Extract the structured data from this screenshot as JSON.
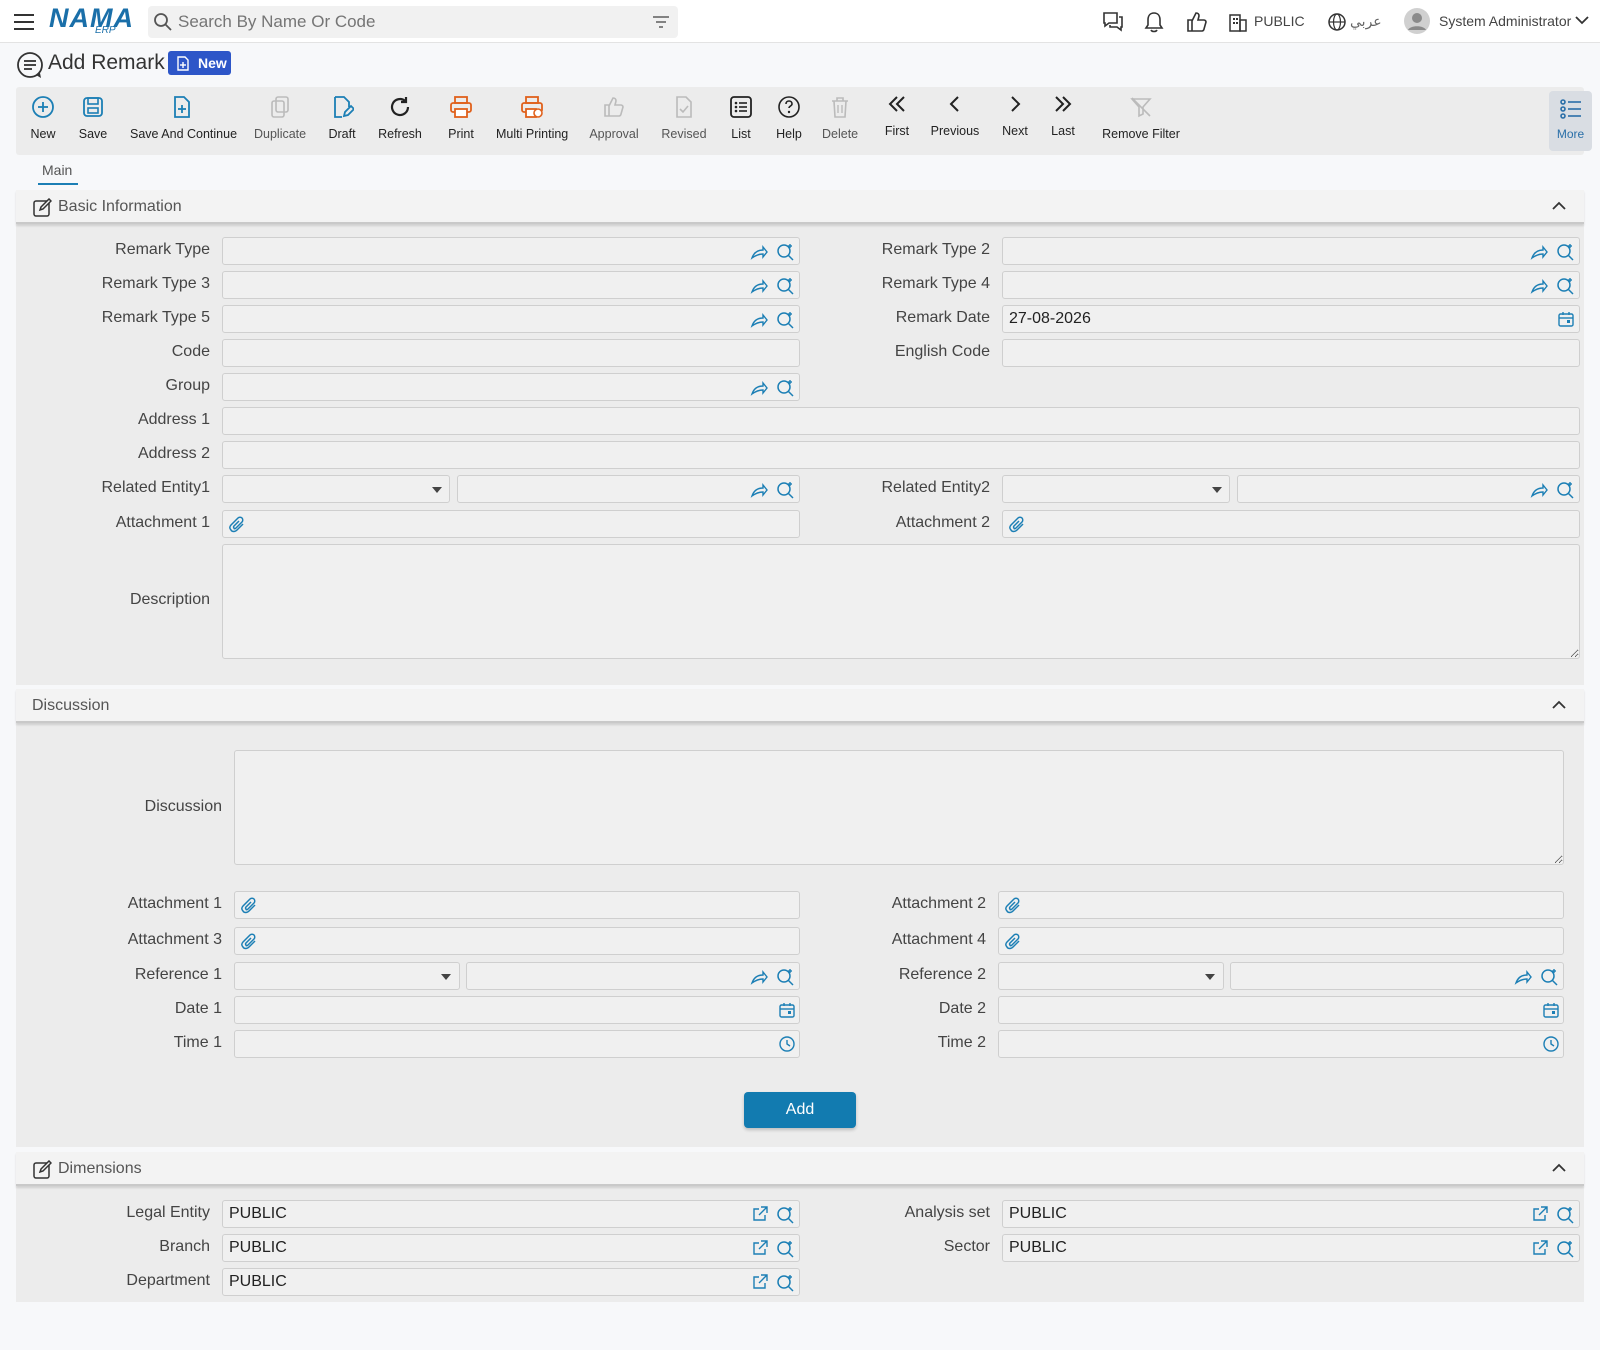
{
  "topbar": {
    "logo": "NAMA",
    "logo_sub": "ERP",
    "search_placeholder": "Search By Name Or Code",
    "company": "PUBLIC",
    "language": "عربي",
    "user": "System Administrator"
  },
  "page": {
    "title": "Add Remark",
    "status_badge": "New"
  },
  "toolbar": {
    "new": "New",
    "save": "Save",
    "save_continue": "Save And Continue",
    "duplicate": "Duplicate",
    "draft": "Draft",
    "refresh": "Refresh",
    "print": "Print",
    "multi_printing": "Multi Printing",
    "approval": "Approval",
    "revised": "Revised",
    "list": "List",
    "help": "Help",
    "delete": "Delete",
    "first": "First",
    "previous": "Previous",
    "next": "Next",
    "last": "Last",
    "remove_filter": "Remove Filter",
    "more": "More"
  },
  "tabs": {
    "main": "Main"
  },
  "basic": {
    "title": "Basic Information",
    "remark_type": "Remark Type",
    "remark_type2": "Remark Type 2",
    "remark_type3": "Remark Type 3",
    "remark_type4": "Remark Type 4",
    "remark_type5": "Remark Type 5",
    "remark_date": "Remark Date",
    "remark_date_value": "27-08-2026",
    "code": "Code",
    "english_code": "English Code",
    "group": "Group",
    "address1": "Address 1",
    "address2": "Address 2",
    "related_entity1": "Related Entity1",
    "related_entity2": "Related Entity2",
    "attachment1": "Attachment 1",
    "attachment2": "Attachment 2",
    "description": "Description"
  },
  "discussion": {
    "title": "Discussion",
    "discussion": "Discussion",
    "attachment1": "Attachment 1",
    "attachment2": "Attachment 2",
    "attachment3": "Attachment 3",
    "attachment4": "Attachment 4",
    "reference1": "Reference 1",
    "reference2": "Reference 2",
    "date1": "Date 1",
    "date2": "Date 2",
    "time1": "Time 1",
    "time2": "Time 2",
    "add_button": "Add"
  },
  "dimensions": {
    "title": "Dimensions",
    "legal_entity": "Legal Entity",
    "legal_entity_value": "PUBLIC",
    "analysis_set": "Analysis set",
    "analysis_set_value": "PUBLIC",
    "branch": "Branch",
    "branch_value": "PUBLIC",
    "sector": "Sector",
    "sector_value": "PUBLIC",
    "department": "Department",
    "department_value": "PUBLIC"
  },
  "colors": {
    "accent": "#127bb0",
    "badge": "#2d56c8",
    "print_orange": "#e0611c",
    "icon_blue": "#1c7fb5"
  },
  "icons": [
    "menu-icon",
    "search-icon",
    "filter-icon",
    "chat-icon",
    "bell-icon",
    "like-icon",
    "building-icon",
    "globe-icon",
    "user-icon",
    "chevron-down-icon",
    "remark-icon",
    "plus-circle-icon",
    "save-icon",
    "file-plus-icon",
    "copy-icon",
    "edit-icon",
    "refresh-icon",
    "printer-icon",
    "multi-printer-icon",
    "thumb-up-icon",
    "file-check-icon",
    "list-icon",
    "help-icon",
    "trash-icon",
    "double-chevron-left-icon",
    "chevron-left-icon",
    "chevron-right-icon",
    "double-chevron-right-icon",
    "filter-off-icon",
    "more-list-icon",
    "forward-icon",
    "search-plus-icon",
    "calendar-icon",
    "clock-icon",
    "paperclip-icon",
    "external-link-icon",
    "chevron-up-icon"
  ]
}
